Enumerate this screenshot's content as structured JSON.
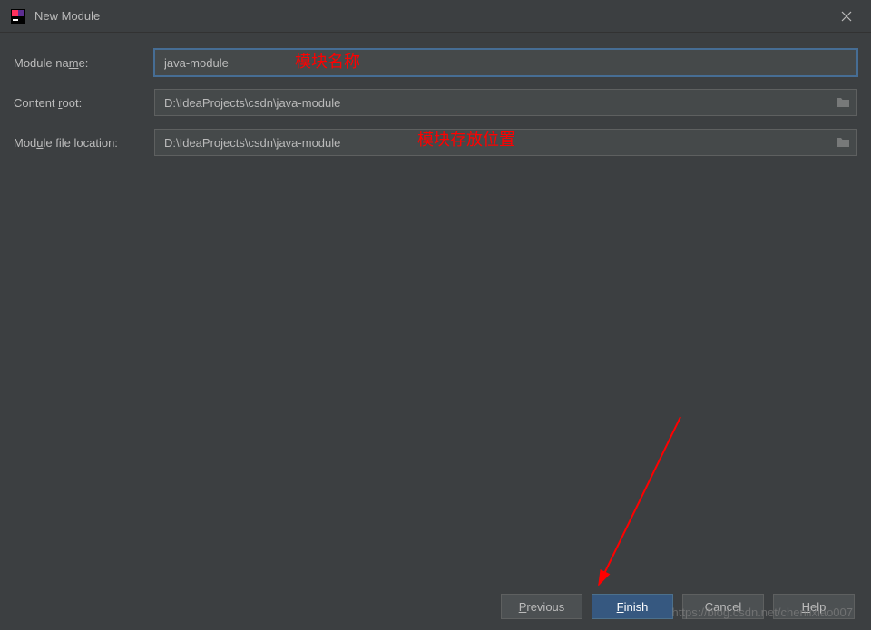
{
  "window": {
    "title": "New Module"
  },
  "form": {
    "moduleName": {
      "label_pre": "Module na",
      "label_u": "m",
      "label_post": "e:",
      "value": "java-module"
    },
    "contentRoot": {
      "label_pre": "Content ",
      "label_u": "r",
      "label_post": "oot:",
      "value": "D:\\IdeaProjects\\csdn\\java-module"
    },
    "moduleFileLocation": {
      "label_pre": "Mod",
      "label_u": "u",
      "label_post": "le file location:",
      "value": "D:\\IdeaProjects\\csdn\\java-module"
    }
  },
  "annotations": {
    "moduleNameHint": "模块名称",
    "locationHint": "模块存放位置"
  },
  "buttons": {
    "previous_u": "P",
    "previous_post": "revious",
    "finish_u": "F",
    "finish_post": "inish",
    "cancel": "Cancel",
    "help_u": "H",
    "help_post": "elp"
  },
  "watermark": "https://blog.csdn.net/chenlixiao007"
}
